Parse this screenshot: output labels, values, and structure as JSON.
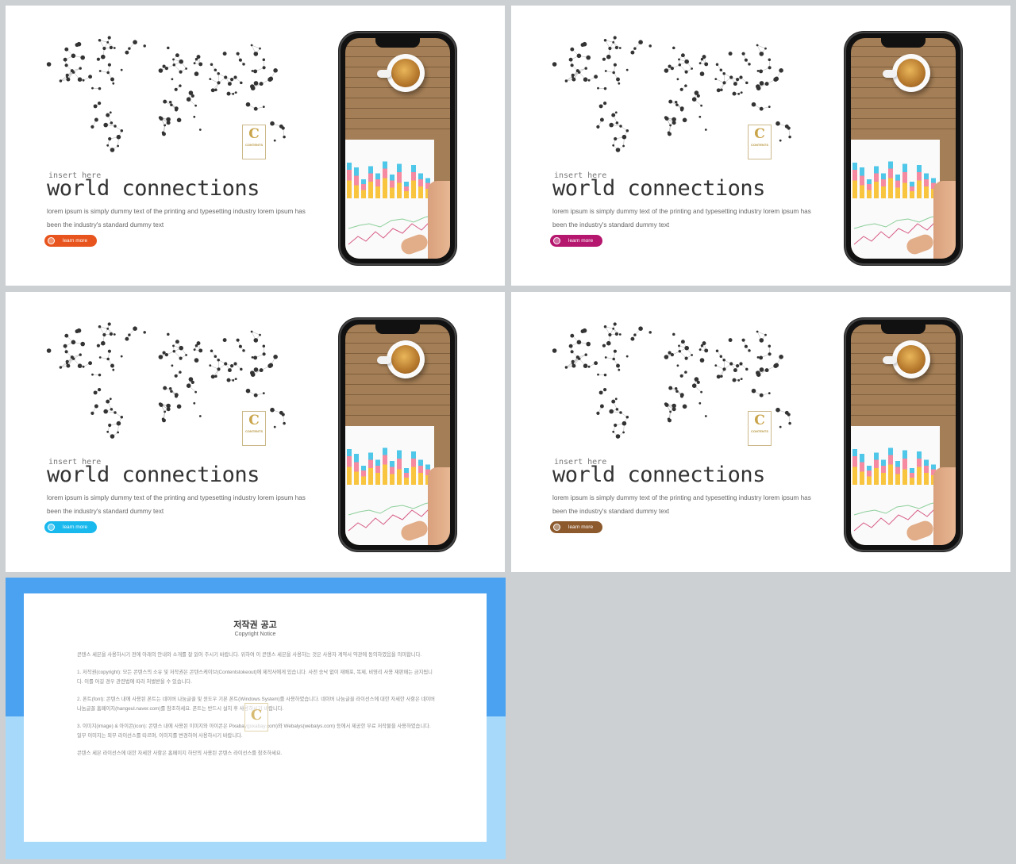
{
  "slides": [
    {
      "insert_label": "insert here",
      "title": "world  connections",
      "description": "lorem ipsum is simply dummy text of the printing and typesetting industry lorem ipsum has been the industry's standard dummy text",
      "button_label": "learn more",
      "accent_color": "#e8541d",
      "logo_letter": "C",
      "logo_text": "CONTENTS"
    },
    {
      "insert_label": "insert here",
      "title": "world  connections",
      "description": "lorem ipsum is simply dummy text of the printing and typesetting industry lorem ipsum has been the industry's standard dummy text",
      "button_label": "learn more",
      "accent_color": "#b5176e",
      "logo_letter": "C",
      "logo_text": "CONTENTS"
    },
    {
      "insert_label": "insert here",
      "title": "world  connections",
      "description": "lorem ipsum is simply dummy text of the printing and typesetting industry lorem ipsum has been the industry's standard dummy text",
      "button_label": "learn more",
      "accent_color": "#19b9ee",
      "logo_letter": "C",
      "logo_text": "CONTENTS"
    },
    {
      "insert_label": "insert here",
      "title": "world  connections",
      "description": "lorem ipsum is simply dummy text of the printing and typesetting industry lorem ipsum has been the industry's standard dummy text",
      "button_label": "learn more",
      "accent_color": "#8d5a2e",
      "logo_letter": "C",
      "logo_text": "CONTENTS"
    }
  ],
  "copyright": {
    "title": "저작권 공고",
    "subtitle": "Copyright Notice",
    "logo_letter": "C",
    "paragraphs": [
      "콘텐스 세븐을 사용하시기 전에 아래의 안내와 소개를 잘 읽어 주시기 바랍니다. 위하여 이 콘텐스 세븐을 사용하는 것은 사용자 계약서 약관에 동의하였음을 의미합니다.",
      "1. 저작권(copyright): 모든 콘텐스의 소유 및 저작권은 콘텐스케이브(Contentstokeout)에 제작사에게 있습니다. 사전 승낙 없이 재배포, 복제, 비영리 사용 재판매는 금지됩니다. 이를 어길 경우 관련법에 따라 처벌받을 수 있습니다.",
      "2. 폰트(font): 콘텐스 내에 사용된 폰트는 네이버 나눔글꼴 및 윈도우 기본 폰트(Windows System)를 사용하였습니다. 네이버 나눔글꼴 라이선스에 대한 자세한 사항은 네이버 나눔글꼴 홈페이지(hangeul.naver.com)를 참조하세요. 폰트는 반드시 설치 후 사용하시기 바랍니다.",
      "3. 이미지(image) & 아이콘(icon): 콘텐스 내에 사용된 이미지와 아이콘은 Pixabay(pixabay.com)와 Webalys(webalys.com) 등에서 제공한 무료 저작물을 사용하였습니다. 일부 이미지는 외부 라이선스를 따르며, 이미지를 변경하여 사용하시기 바랍니다.",
      "콘텐스 세븐 라이선스에 대한 자세한 사항은 홈페이지 하단의 사용된 콘텐스 라이선스를 참조하세요."
    ]
  }
}
